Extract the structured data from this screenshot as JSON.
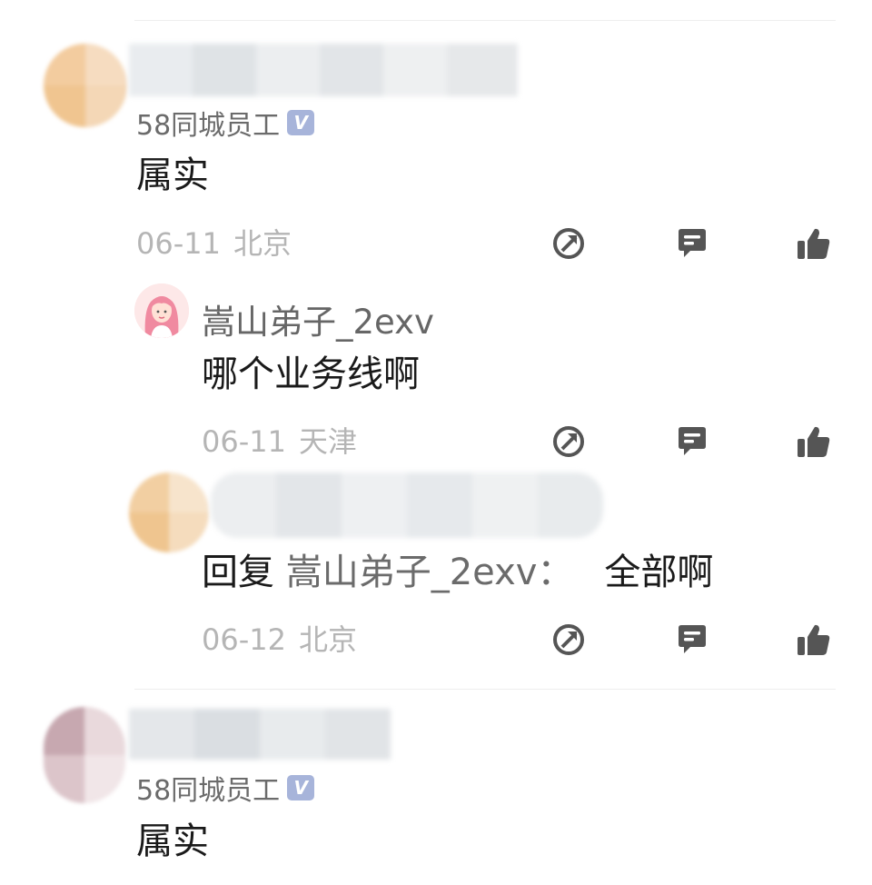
{
  "comments": [
    {
      "badge_text": "58同城员工",
      "badge_icon": "verified-v-icon",
      "text": "属实",
      "date": "06-11",
      "location": "北京",
      "replies": [
        {
          "username": "嵩山弟子_2exv",
          "text": "哪个业务线啊",
          "date": "06-11",
          "location": "天津"
        },
        {
          "reply_prefix": "回复",
          "reply_target": "嵩山弟子_2exv：",
          "text": "全部啊",
          "date": "06-12",
          "location": "北京"
        }
      ]
    },
    {
      "badge_text": "58同城员工",
      "badge_icon": "verified-v-icon",
      "text": "属实"
    }
  ],
  "badge_letter": "V",
  "action_icons": [
    "share-icon",
    "comment-icon",
    "like-icon"
  ],
  "colors": {
    "meta_gray": "#b5b5b5",
    "badge_blue": "#a7b4da",
    "icon_gray": "#555555"
  }
}
